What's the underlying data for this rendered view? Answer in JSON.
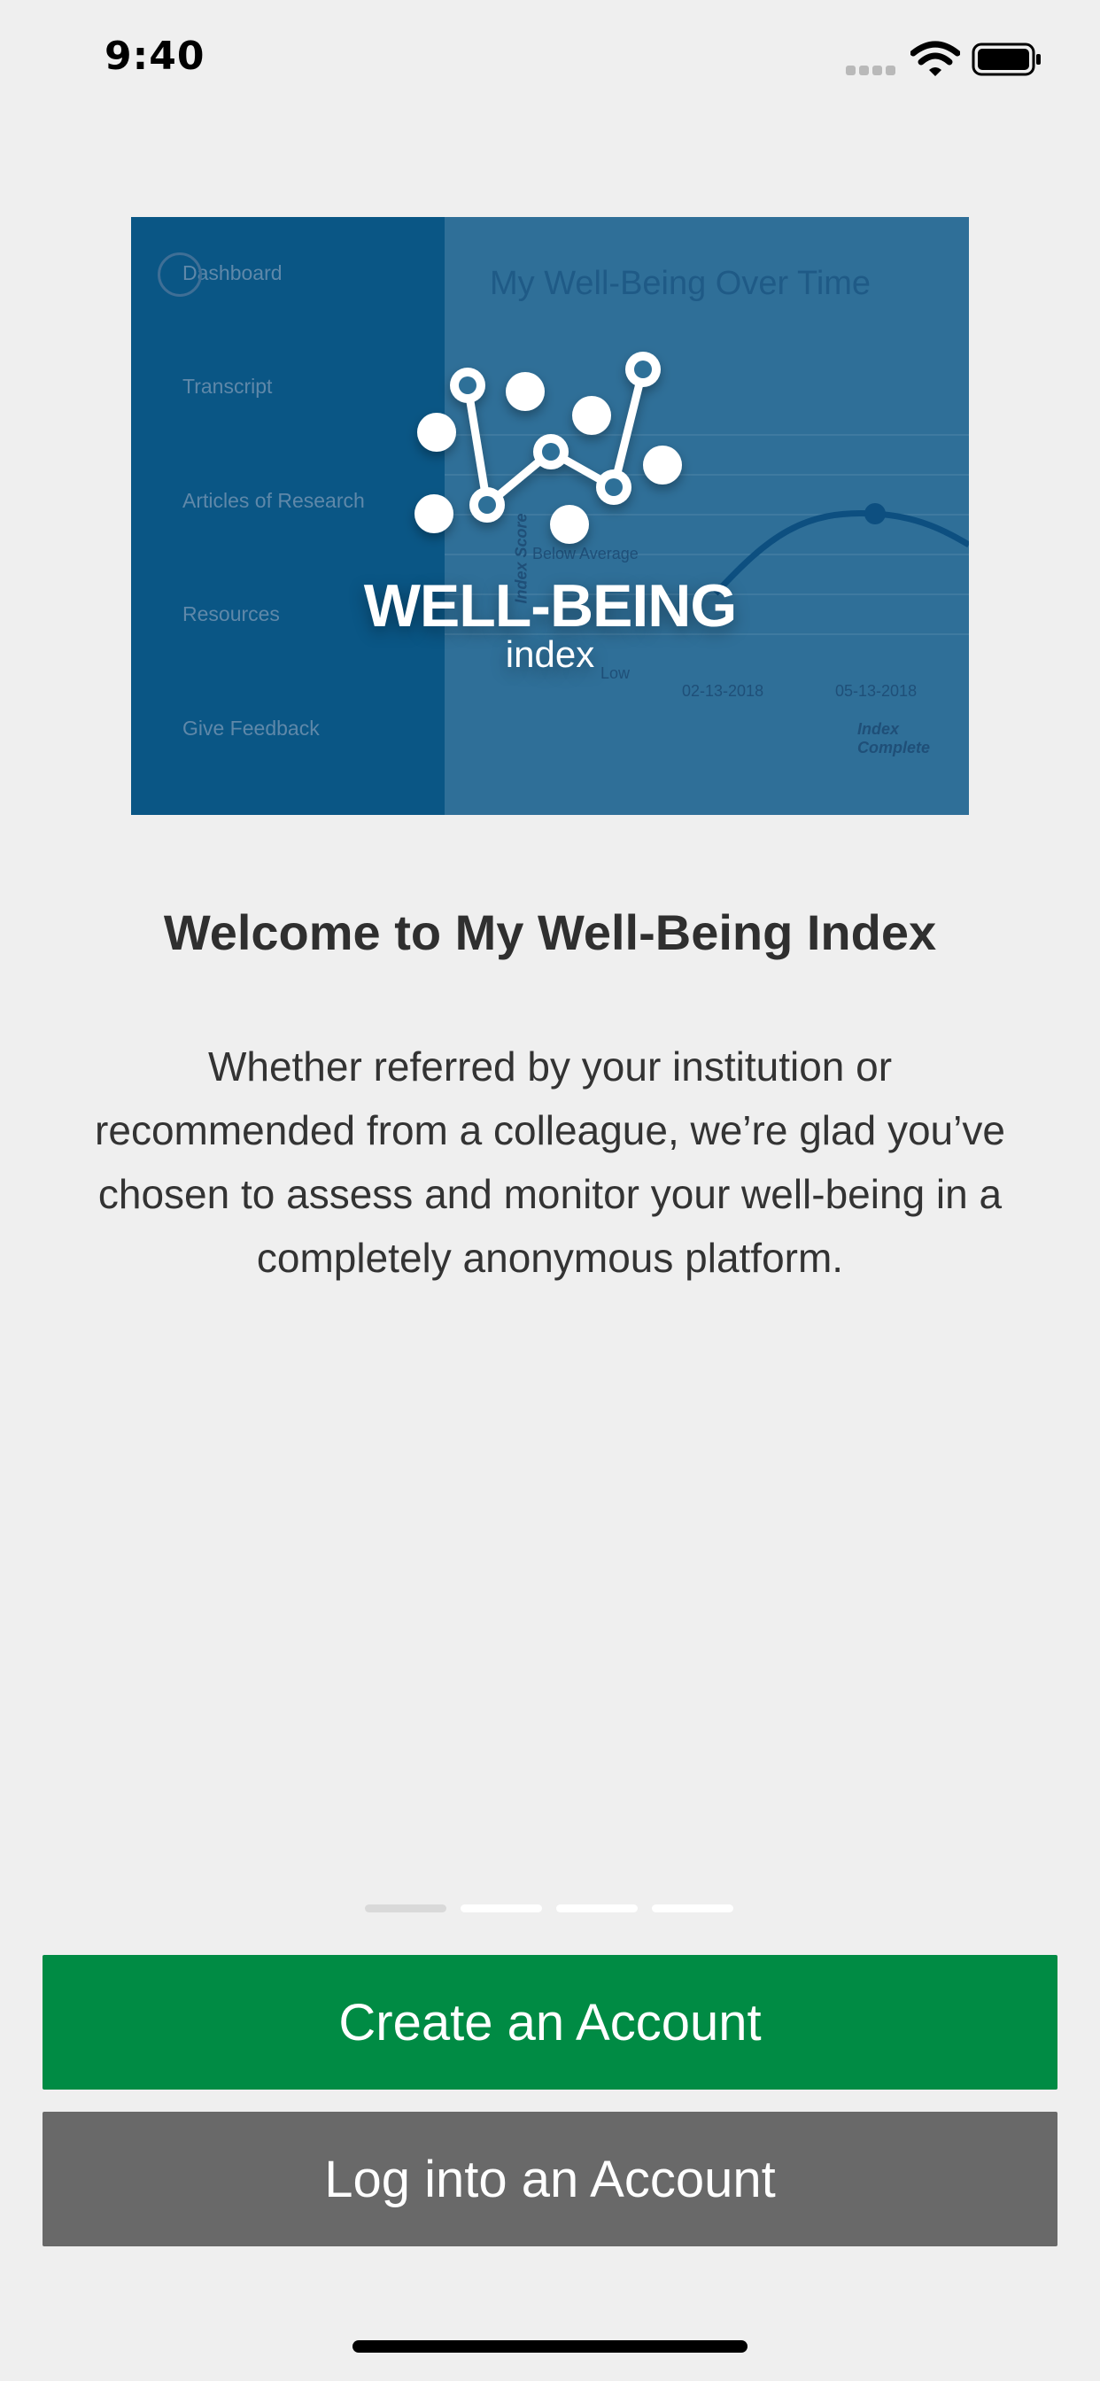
{
  "status_bar": {
    "time": "9:40"
  },
  "hero": {
    "sidebar_items": [
      "Dashboard",
      "Transcript",
      "Articles of Research",
      "Resources",
      "Give Feedback"
    ],
    "chart_title": "My Well-Being Over Time",
    "axis_labels": {
      "y": "Index Score",
      "x": "Index Complete"
    },
    "band_labels": [
      "Below Average",
      "Low"
    ],
    "dates": [
      "02-13-2018",
      "05-13-2018"
    ],
    "logo": {
      "main": "WELL-BEING",
      "sub": "index"
    }
  },
  "welcome": {
    "title": "Welcome to My Well-Being Index",
    "body": "Whether referred by your institution or recommended from a colleague, we’re glad you’ve chosen to assess and monitor your well-being in a completely anonymous platform."
  },
  "pager": {
    "pages": 4,
    "current": 1
  },
  "actions": {
    "create": "Create an Account",
    "login": "Log into an Account"
  },
  "colors": {
    "create_button": "#008b44",
    "login_button": "#696969",
    "background": "#efefef"
  }
}
